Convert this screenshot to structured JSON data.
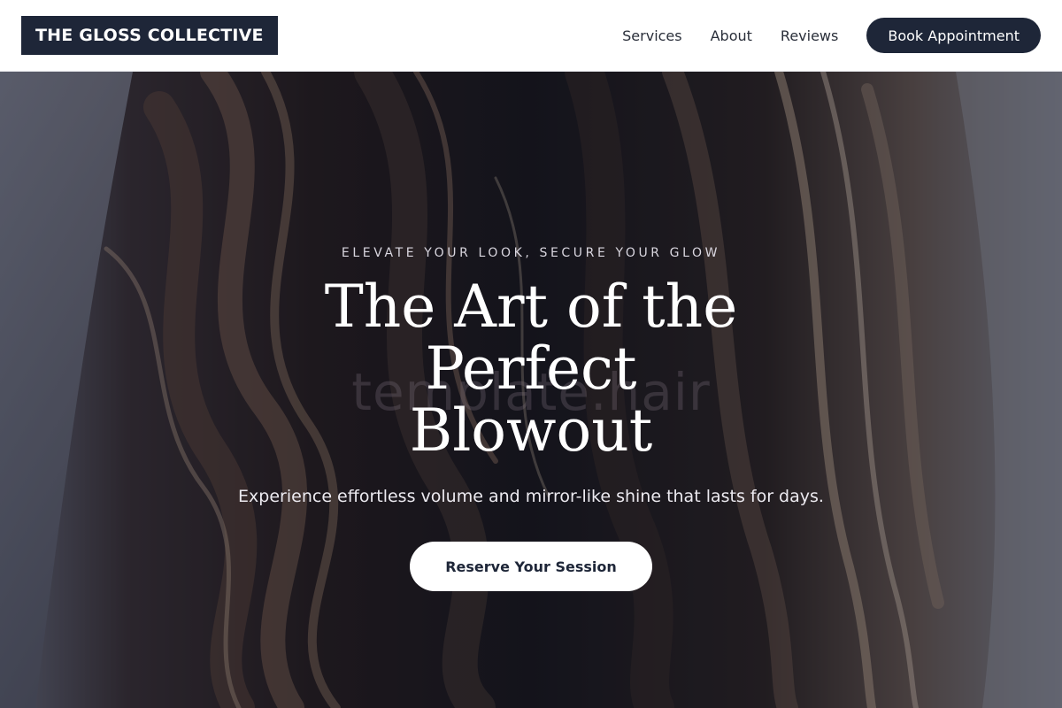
{
  "brand": {
    "name": "THE GLOSS COLLECTIVE"
  },
  "nav": {
    "links": [
      "Services",
      "About",
      "Reviews"
    ],
    "cta_label": "Book Appointment"
  },
  "hero": {
    "tagline": "ELEVATE YOUR LOOK, SECURE YOUR GLOW",
    "headline_line1": "The Art of the Perfect",
    "headline_line2": "Blowout",
    "subheadline": "Experience effortless volume and mirror-like shine that lasts for days.",
    "cta_label": "Reserve Your Session",
    "watermark": "template.hair",
    "background_image": "hair-waves-photo"
  },
  "colors": {
    "brand_navy": "#1e2638",
    "nav_bg": "#ffffff",
    "hero_text": "#ffffff"
  }
}
